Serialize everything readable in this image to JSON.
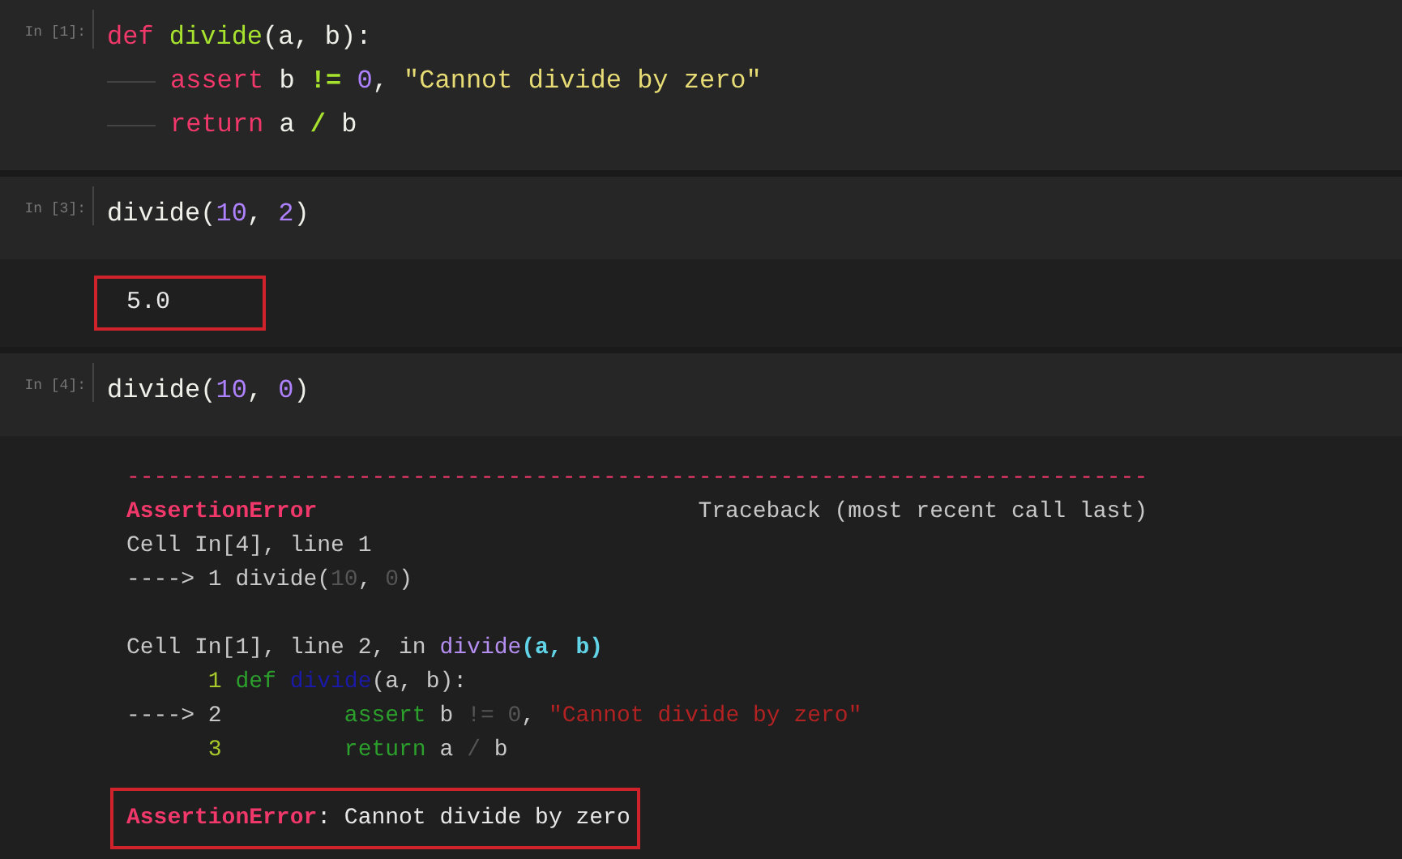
{
  "cells": [
    {
      "prompt": "In [1]:",
      "lines": [
        {
          "indent": false,
          "tokens": [
            {
              "kind": "keyword",
              "text": "def "
            },
            {
              "kind": "function",
              "text": "divide"
            },
            {
              "kind": "plain",
              "text": "(a, b):"
            }
          ]
        },
        {
          "indent": true,
          "tokens": [
            {
              "kind": "keyword",
              "text": "assert"
            },
            {
              "kind": "plain",
              "text": " b "
            },
            {
              "kind": "operator",
              "text": "!= "
            },
            {
              "kind": "number",
              "text": "0"
            },
            {
              "kind": "plain",
              "text": ", "
            },
            {
              "kind": "string",
              "text": "\"Cannot divide by zero\""
            }
          ]
        },
        {
          "indent": true,
          "tokens": [
            {
              "kind": "keyword",
              "text": "return"
            },
            {
              "kind": "plain",
              "text": " a "
            },
            {
              "kind": "operator",
              "text": "/"
            },
            {
              "kind": "plain",
              "text": " b"
            }
          ]
        }
      ]
    },
    {
      "prompt": "In [3]:",
      "lines": [
        {
          "indent": false,
          "tokens": [
            {
              "kind": "plain",
              "text": "divide("
            },
            {
              "kind": "number",
              "text": "10"
            },
            {
              "kind": "plain",
              "text": ", "
            },
            {
              "kind": "number",
              "text": "2"
            },
            {
              "kind": "plain",
              "text": ")"
            }
          ]
        }
      ],
      "output": {
        "kind": "result",
        "text": "5.0",
        "highlighted": true
      }
    },
    {
      "prompt": "In [4]:",
      "lines": [
        {
          "indent": false,
          "tokens": [
            {
              "kind": "plain",
              "text": "divide("
            },
            {
              "kind": "number",
              "text": "10"
            },
            {
              "kind": "plain",
              "text": ", "
            },
            {
              "kind": "number",
              "text": "0"
            },
            {
              "kind": "plain",
              "text": ")"
            }
          ]
        }
      ],
      "output": {
        "kind": "traceback",
        "rule": "---------------------------------------------------------------------------",
        "error": "AssertionError",
        "header": "Traceback (most recent call last)",
        "lines": [
          {
            "kind": "code",
            "tokens": [
              {
                "kind": "tb_plain",
                "text": "Cell In[4], line 1"
              }
            ]
          },
          {
            "kind": "code",
            "tokens": [
              {
                "kind": "tb_plain",
                "text": "----> 1 divide("
              },
              {
                "kind": "tb_dim",
                "text": "10"
              },
              {
                "kind": "tb_plain",
                "text": ", "
              },
              {
                "kind": "tb_dim",
                "text": "0"
              },
              {
                "kind": "tb_plain",
                "text": ")"
              }
            ]
          },
          {
            "kind": "blank"
          },
          {
            "kind": "code",
            "tokens": [
              {
                "kind": "tb_plain",
                "text": "Cell In[1], line 2, in "
              },
              {
                "kind": "tb_fname",
                "text": "divide"
              },
              {
                "kind": "tb_args",
                "text": "(a, b)"
              }
            ]
          },
          {
            "kind": "code",
            "tokens": [
              {
                "kind": "tb_lineno",
                "text": "      1 "
              },
              {
                "kind": "tb_keyword",
                "text": "def "
              },
              {
                "kind": "tb_func",
                "text": "divide"
              },
              {
                "kind": "tb_plain",
                "text": "(a, b):"
              }
            ]
          },
          {
            "kind": "code",
            "tokens": [
              {
                "kind": "tb_plain",
                "text": "----> 2         "
              },
              {
                "kind": "tb_keyword",
                "text": "assert"
              },
              {
                "kind": "tb_plain",
                "text": " b "
              },
              {
                "kind": "tb_dim",
                "text": "!= 0"
              },
              {
                "kind": "tb_plain",
                "text": ", "
              },
              {
                "kind": "tb_string",
                "text": "\"Cannot divide by zero\""
              }
            ]
          },
          {
            "kind": "code",
            "tokens": [
              {
                "kind": "tb_lineno",
                "text": "      3         "
              },
              {
                "kind": "tb_keyword",
                "text": "return"
              },
              {
                "kind": "tb_plain",
                "text": " a "
              },
              {
                "kind": "tb_dim",
                "text": "/"
              },
              {
                "kind": "tb_plain",
                "text": " b"
              }
            ]
          }
        ],
        "final": {
          "error": "AssertionError",
          "message": ": Cannot divide by zero",
          "highlighted": true
        }
      }
    }
  ]
}
